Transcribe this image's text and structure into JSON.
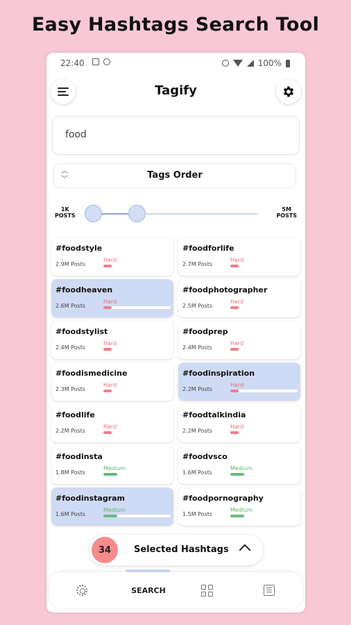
{
  "promo": {
    "title": "Easy Hashtags Search Tool"
  },
  "statusbar": {
    "time": "22:40",
    "battery": "100%"
  },
  "appbar": {
    "title": "Tagify",
    "menu_icon": "hamburger-icon",
    "settings_icon": "gear-icon"
  },
  "search": {
    "value": "food"
  },
  "order": {
    "label": "Tags Order",
    "icon": "sort-updown-icon"
  },
  "range": {
    "min_label_line1": "1K",
    "min_label_line2": "POSTS",
    "max_label_line1": "5M",
    "max_label_line2": "POSTS"
  },
  "hashtags": [
    {
      "tag": "#foodstyle",
      "posts": "2.9M Posts",
      "difficulty": "Hard",
      "selected": false
    },
    {
      "tag": "#foodforlife",
      "posts": "2.7M Posts",
      "difficulty": "Hard",
      "selected": false
    },
    {
      "tag": "#foodheaven",
      "posts": "2.6M Posts",
      "difficulty": "Hard",
      "selected": true
    },
    {
      "tag": "#foodphotographer",
      "posts": "2.5M Posts",
      "difficulty": "Hard",
      "selected": false
    },
    {
      "tag": "#foodstylist",
      "posts": "2.4M Posts",
      "difficulty": "Hard",
      "selected": false
    },
    {
      "tag": "#foodprep",
      "posts": "2.4M Posts",
      "difficulty": "Hard",
      "selected": false
    },
    {
      "tag": "#foodismedicine",
      "posts": "2.3M Posts",
      "difficulty": "Hard",
      "selected": false
    },
    {
      "tag": "#foodinspiration",
      "posts": "2.2M Posts",
      "difficulty": "Hard",
      "selected": true
    },
    {
      "tag": "#foodlife",
      "posts": "2.2M Posts",
      "difficulty": "Hard",
      "selected": false
    },
    {
      "tag": "#foodtalkindia",
      "posts": "2.2M Posts",
      "difficulty": "Hard",
      "selected": false
    },
    {
      "tag": "#foodinsta",
      "posts": "1.8M Posts",
      "difficulty": "Medium",
      "selected": false
    },
    {
      "tag": "#foodvsco",
      "posts": "1.6M Posts",
      "difficulty": "Medium",
      "selected": false
    },
    {
      "tag": "#foodinstagram",
      "posts": "1.6M Posts",
      "difficulty": "Medium",
      "selected": true
    },
    {
      "tag": "#foodpornography",
      "posts": "1.5M Posts",
      "difficulty": "Medium",
      "selected": false
    }
  ],
  "selected_bar": {
    "count": "34",
    "label": "Selected Hashtags"
  },
  "bottom_nav": {
    "search_label": "SEARCH",
    "active": "search"
  },
  "colors": {
    "selected_card": "#cfdaf4",
    "hard": "#ef7f86",
    "medium": "#69bb79",
    "badge": "#f48c8c"
  }
}
